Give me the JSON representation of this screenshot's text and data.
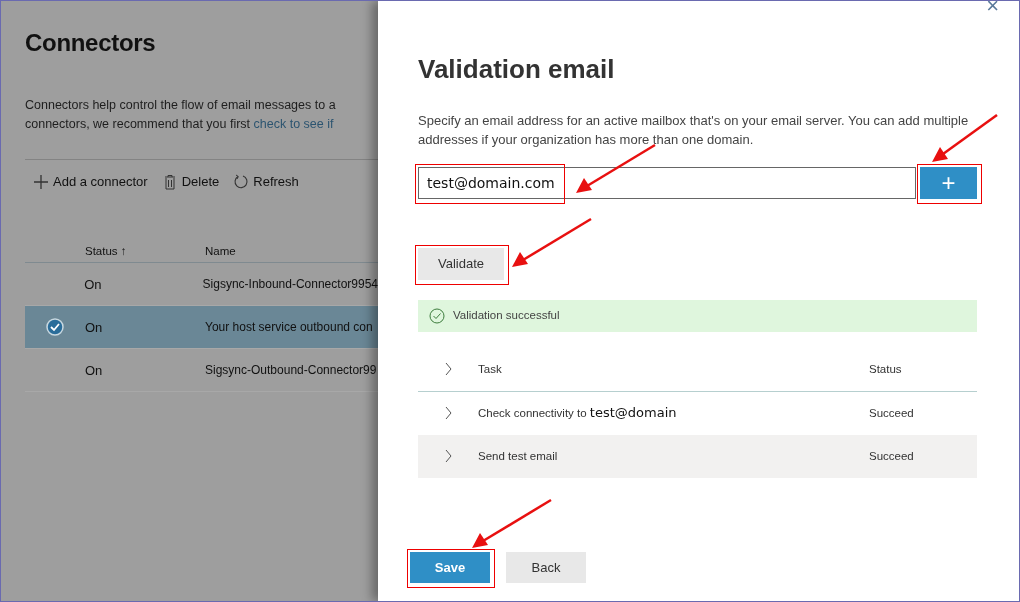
{
  "background_page": {
    "title": "Connectors",
    "description": [
      "Connectors help control the flow of email messages to a",
      "connectors, we recommend that you first "
    ],
    "description_link": "check to see if",
    "toolbar": [
      {
        "kind": "add",
        "label": "Add a connector"
      },
      {
        "kind": "delete",
        "label": "Delete"
      },
      {
        "kind": "refresh",
        "label": "Refresh"
      }
    ],
    "table": {
      "columns": [
        "Status ↑",
        "Name"
      ],
      "rows": [
        {
          "selected": false,
          "status": "On",
          "name": "Sigsync-Inbound-Connector9954"
        },
        {
          "selected": true,
          "status": "On",
          "name": "Your host service outbound con"
        },
        {
          "selected": false,
          "status": "On",
          "name": "Sigsync-Outbound-Connector99"
        }
      ]
    }
  },
  "panel": {
    "close": "×",
    "title": "Validation email",
    "description": "Specify an email address for an active mailbox that's on your email server. You can add multiple addresses if your organization has more than one domain.",
    "email_field": {
      "value": "test@domain.com",
      "highlighted": true
    },
    "add_button": {
      "label": "+",
      "highlighted": true
    },
    "validate_button": {
      "label": "Validate",
      "highlighted": true
    },
    "result": "Validation successful",
    "tasks": {
      "columns": [
        "Task",
        "Status"
      ],
      "rows": [
        {
          "task": "Check connectivity to ",
          "target": "test@domain",
          "status": "Succeed"
        },
        {
          "task": "Send test email",
          "status": "Succeed"
        }
      ]
    },
    "buttons": [
      {
        "kind": "primary",
        "label": "Save",
        "highlighted": true
      },
      {
        "kind": "secondary",
        "label": "Back",
        "highlighted": false
      }
    ]
  }
}
